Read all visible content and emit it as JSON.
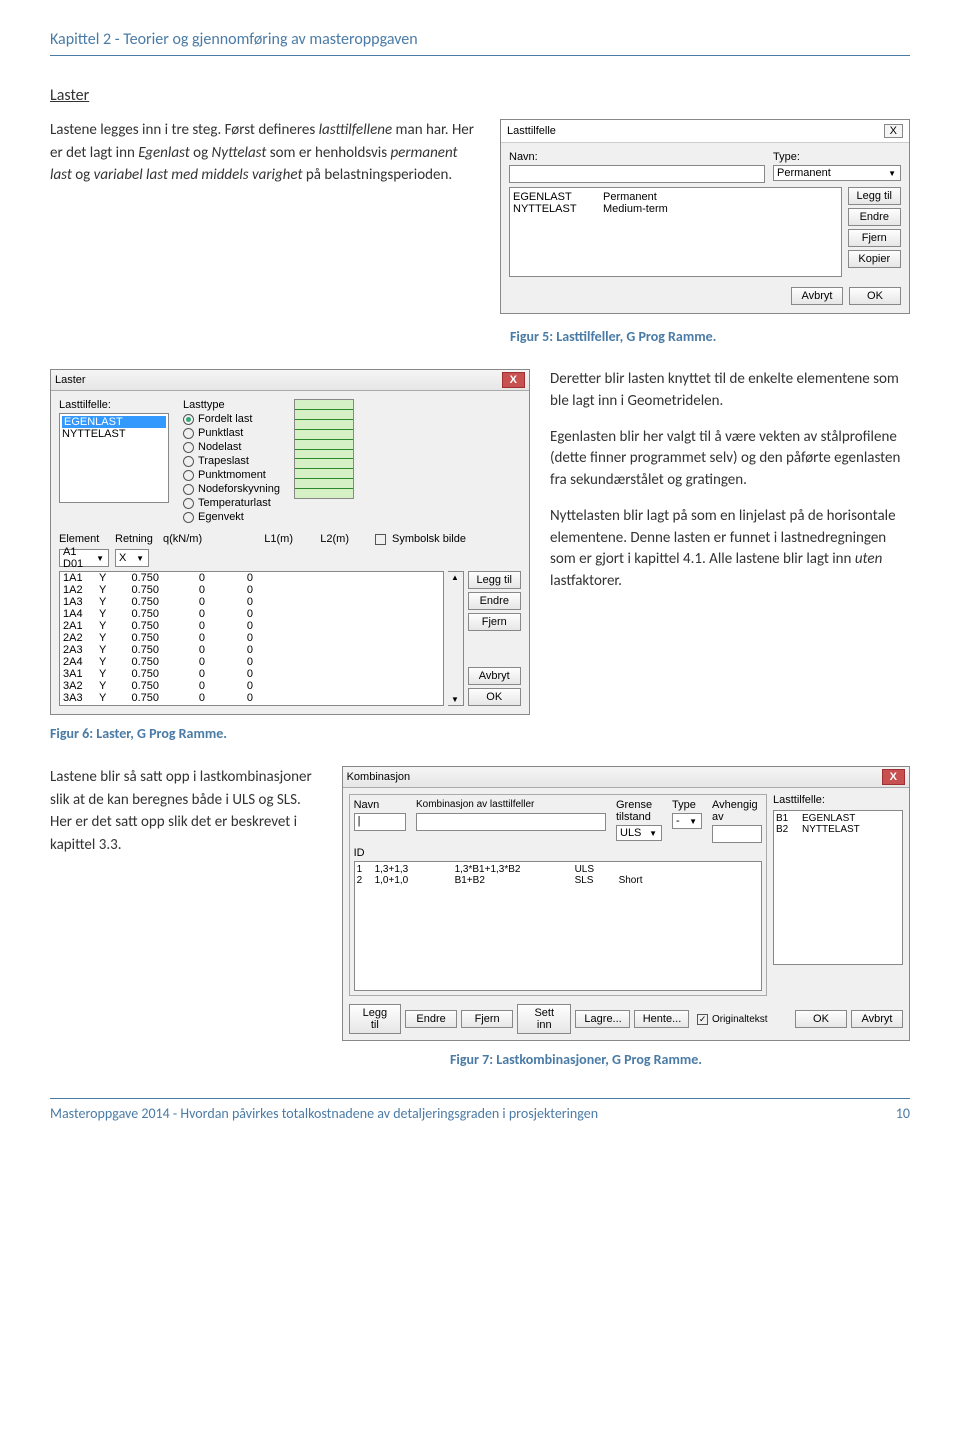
{
  "header": "Kapittel 2 - Teorier og gjennomføring av masteroppgaven",
  "section": {
    "heading": "Laster",
    "para1a": "Lastene legges inn i tre steg. Først defineres ",
    "para1b": "lasttilfellene",
    "para1c": " man har. Her er det lagt inn ",
    "para1d": "Egenlast",
    "para1e": " og ",
    "para1f": "Nyttelast",
    "para1g": " som er henholdsvis ",
    "para1h": "permanent last",
    "para1i": " og ",
    "para1j": "variabel last med middels varighet",
    "para1k": " på belastningsperioden."
  },
  "dlg1": {
    "title": "Lasttilfelle",
    "close": "X",
    "navn_lbl": "Navn:",
    "type_lbl": "Type:",
    "type_val": "Permanent",
    "list": [
      {
        "name": "EGENLAST",
        "type": "Permanent"
      },
      {
        "name": "NYTTELAST",
        "type": "Medium-term"
      }
    ],
    "btn_leggtil": "Legg til",
    "btn_endre": "Endre",
    "btn_fjern": "Fjern",
    "btn_kopier": "Kopier",
    "btn_avbryt": "Avbryt",
    "btn_ok": "OK"
  },
  "caption5": "Figur 5: Lasttilfeller, G Prog Ramme.",
  "dlg2": {
    "title": "Laster",
    "lt_lbl": "Lasttilfelle:",
    "lt_items": [
      "EGENLAST",
      "NYTTELAST"
    ],
    "lasttype_lbl": "Lasttype",
    "radios": [
      "Fordelt last",
      "Punktlast",
      "Nodelast",
      "Trapeslast",
      "Punktmoment",
      "Nodeforskyvning",
      "Temperaturlast",
      "Egenvekt"
    ],
    "elem_lbl": "Element",
    "retning_lbl": "Retning",
    "q_lbl": "q(kN/m)",
    "l1_lbl": "L1(m)",
    "l2_lbl": "L2(m)",
    "sym_lbl": "Symbolsk bilde",
    "elem_val": "A1 D01",
    "retning_val": "X",
    "rows": [
      {
        "id": "1A1",
        "r": "Y",
        "q": "0.750",
        "l1": "0",
        "l2": "0"
      },
      {
        "id": "1A2",
        "r": "Y",
        "q": "0.750",
        "l1": "0",
        "l2": "0"
      },
      {
        "id": "1A3",
        "r": "Y",
        "q": "0.750",
        "l1": "0",
        "l2": "0"
      },
      {
        "id": "1A4",
        "r": "Y",
        "q": "0.750",
        "l1": "0",
        "l2": "0"
      },
      {
        "id": "2A1",
        "r": "Y",
        "q": "0.750",
        "l1": "0",
        "l2": "0"
      },
      {
        "id": "2A2",
        "r": "Y",
        "q": "0.750",
        "l1": "0",
        "l2": "0"
      },
      {
        "id": "2A3",
        "r": "Y",
        "q": "0.750",
        "l1": "0",
        "l2": "0"
      },
      {
        "id": "2A4",
        "r": "Y",
        "q": "0.750",
        "l1": "0",
        "l2": "0"
      },
      {
        "id": "3A1",
        "r": "Y",
        "q": "0.750",
        "l1": "0",
        "l2": "0"
      },
      {
        "id": "3A2",
        "r": "Y",
        "q": "0.750",
        "l1": "0",
        "l2": "0"
      },
      {
        "id": "3A3",
        "r": "Y",
        "q": "0.750",
        "l1": "0",
        "l2": "0"
      }
    ],
    "btn_leggtil": "Legg til",
    "btn_endre": "Endre",
    "btn_fjern": "Fjern",
    "btn_avbryt": "Avbryt",
    "btn_ok": "OK"
  },
  "row2text": {
    "p1": "Deretter blir lasten knyttet til de enkelte elementene som ble lagt inn i Geometridelen.",
    "p2": "Egenlasten blir her valgt til å være vekten av stålprofilene (dette finner programmet selv) og den påførte egenlasten fra sekundærstålet og gratingen.",
    "p3a": "Nyttelasten blir lagt på som en linjelast på de horisontale elementene. Denne lasten er funnet i lastnedregningen som er gjort i kapittel 4.1. Alle lastene blir lagt inn ",
    "p3b": "uten",
    "p3c": " lastfaktorer."
  },
  "caption6": "Figur 6: Laster, G Prog Ramme.",
  "row3text": "Lastene blir så satt opp i lastkombinasjoner slik at de kan beregnes både i ULS og SLS. Her er det satt opp slik det er beskrevet i kapittel 3.3.",
  "dlg3": {
    "title": "Kombinasjon",
    "navn_lbl": "Navn",
    "komb_lbl": "Kombinasjon av lasttilfeller",
    "grense_lbl": "Grense tilstand",
    "type_lbl": "Type",
    "avh_lbl": "Avhengig av",
    "grense_val": "ULS",
    "type_val": "-",
    "id_lbl": "ID",
    "lt_lbl": "Lasttilfelle:",
    "lt_rows": [
      {
        "id": "B1",
        "name": "EGENLAST"
      },
      {
        "id": "B2",
        "name": "NYTTELAST"
      }
    ],
    "rows": [
      {
        "id": "1",
        "f": "1,3+1,3",
        "k": "1,3*B1+1,3*B2",
        "g": "ULS",
        "t": ""
      },
      {
        "id": "2",
        "f": "1,0+1,0",
        "k": "B1+B2",
        "g": "SLS",
        "t": "Short"
      }
    ],
    "btn_leggtil": "Legg til",
    "btn_endre": "Endre",
    "btn_fjern": "Fjern",
    "btn_settinn": "Sett inn",
    "btn_lagre": "Lagre...",
    "btn_hente": "Hente...",
    "chk_orig": "Originaltekst",
    "btn_ok": "OK",
    "btn_avbryt": "Avbryt"
  },
  "caption7": "Figur 7: Lastkombinasjoner, G Prog Ramme.",
  "footer": {
    "text": "Masteroppgave 2014 - Hvordan påvirkes totalkostnadene av detaljeringsgraden i prosjekteringen",
    "page": "10"
  }
}
